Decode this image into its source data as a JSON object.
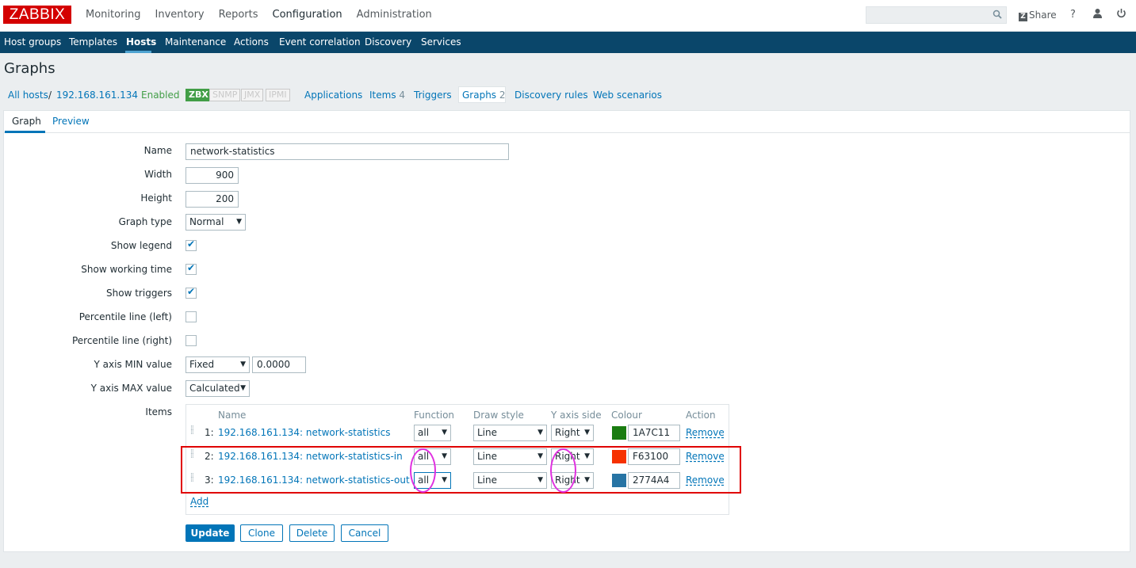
{
  "app": {
    "logo": "ZABBIX",
    "top_nav": [
      "Monitoring",
      "Inventory",
      "Reports",
      "Configuration",
      "Administration"
    ],
    "top_nav_active": "Configuration",
    "share_label": "Share",
    "help_icon": "question-icon",
    "user_icon": "user-icon",
    "logout_icon": "power-icon"
  },
  "sub_nav": {
    "items": [
      "Host groups",
      "Templates",
      "Hosts",
      "Maintenance",
      "Actions",
      "Event correlation",
      "Discovery",
      "Services"
    ],
    "active": "Hosts"
  },
  "page": {
    "title": "Graphs"
  },
  "host_header": {
    "all_hosts": "All hosts",
    "separator": "/",
    "host": "192.168.161.134",
    "status": "Enabled",
    "badges": [
      "ZBX",
      "SNMP",
      "JMX",
      "IPMI"
    ],
    "links": {
      "applications": "Applications",
      "items": "Items",
      "items_count": "4",
      "triggers": "Triggers",
      "graphs": "Graphs",
      "graphs_count": "2",
      "discovery": "Discovery rules",
      "web": "Web scenarios"
    }
  },
  "tabs": [
    "Graph",
    "Preview"
  ],
  "form": {
    "name_label": "Name",
    "name_value": "network-statistics",
    "width_label": "Width",
    "width_value": "900",
    "height_label": "Height",
    "height_value": "200",
    "graph_type_label": "Graph type",
    "graph_type_value": "Normal",
    "show_legend_label": "Show legend",
    "show_working_time_label": "Show working time",
    "show_triggers_label": "Show triggers",
    "percentile_left_label": "Percentile line (left)",
    "percentile_right_label": "Percentile line (right)",
    "ymin_label": "Y axis MIN value",
    "ymin_type": "Fixed",
    "ymin_value": "0.0000",
    "ymax_label": "Y axis MAX value",
    "ymax_type": "Calculated",
    "items_label": "Items"
  },
  "items_table": {
    "headers": [
      "Name",
      "Function",
      "Draw style",
      "Y axis side",
      "Colour",
      "Action"
    ],
    "rows": [
      {
        "num": "1:",
        "name": "192.168.161.134: network-statistics",
        "function": "all",
        "draw_style": "Line",
        "y_axis": "Right",
        "colour_hex": "1A7C11",
        "colour": "#1A7C11",
        "action": "Remove"
      },
      {
        "num": "2:",
        "name": "192.168.161.134: network-statistics-in",
        "function": "all",
        "draw_style": "Line",
        "y_axis": "Right",
        "colour_hex": "F63100",
        "colour": "#F63100",
        "action": "Remove"
      },
      {
        "num": "3:",
        "name": "192.168.161.134: network-statistics-out",
        "function": "all",
        "draw_style": "Line",
        "y_axis": "Right",
        "colour_hex": "2774A4",
        "colour": "#2774A4",
        "action": "Remove"
      }
    ],
    "add_label": "Add"
  },
  "buttons": {
    "update": "Update",
    "clone": "Clone",
    "delete": "Delete",
    "cancel": "Cancel"
  }
}
